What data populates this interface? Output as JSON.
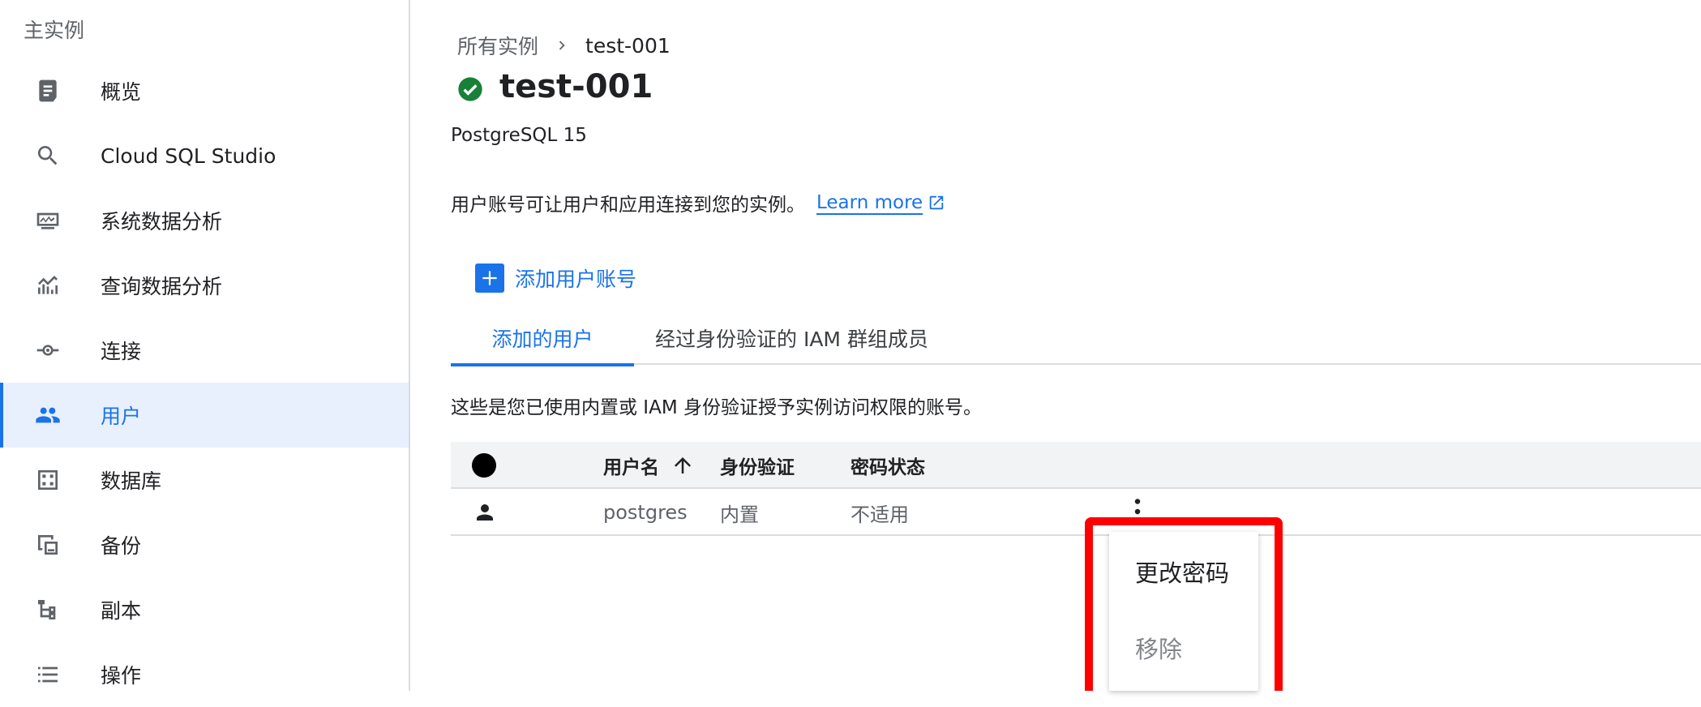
{
  "sidebar": {
    "header": "主实例",
    "items": [
      {
        "label": "概览",
        "icon": "overview-icon",
        "active": false
      },
      {
        "label": "Cloud SQL Studio",
        "icon": "search-icon",
        "active": false
      },
      {
        "label": "系统数据分析",
        "icon": "system-insights-icon",
        "active": false
      },
      {
        "label": "查询数据分析",
        "icon": "query-insights-icon",
        "active": false
      },
      {
        "label": "连接",
        "icon": "connections-icon",
        "active": false
      },
      {
        "label": "用户",
        "icon": "users-icon",
        "active": true
      },
      {
        "label": "数据库",
        "icon": "databases-icon",
        "active": false
      },
      {
        "label": "备份",
        "icon": "backups-icon",
        "active": false
      },
      {
        "label": "副本",
        "icon": "replicas-icon",
        "active": false
      },
      {
        "label": "操作",
        "icon": "operations-icon",
        "active": false
      }
    ]
  },
  "breadcrumb": {
    "parent": "所有实例",
    "current": "test-001"
  },
  "instance": {
    "name": "test-001",
    "status_icon": "check-circle-icon",
    "status_color": "#188038",
    "version": "PostgreSQL 15"
  },
  "intro": {
    "text": "用户账号可让用户和应用连接到您的实例。",
    "learn_more": "Learn more"
  },
  "add_user": {
    "label": "添加用户账号"
  },
  "tabs": [
    {
      "label": "添加的用户",
      "active": true
    },
    {
      "label": "经过身份验证的 IAM 群组成员",
      "active": false
    }
  ],
  "description": "这些是您已使用内置或 IAM 身份验证授予实例访问权限的账号。",
  "table": {
    "columns": [
      "用户名",
      "身份验证",
      "密码状态"
    ],
    "sort": "ascending",
    "rows": [
      {
        "username": "postgres",
        "auth": "内置",
        "password_status": "不适用"
      }
    ]
  },
  "menu": {
    "change_password": "更改密码",
    "remove": "移除"
  },
  "colors": {
    "accent": "#1a73e8",
    "highlight": "#ff0000"
  }
}
